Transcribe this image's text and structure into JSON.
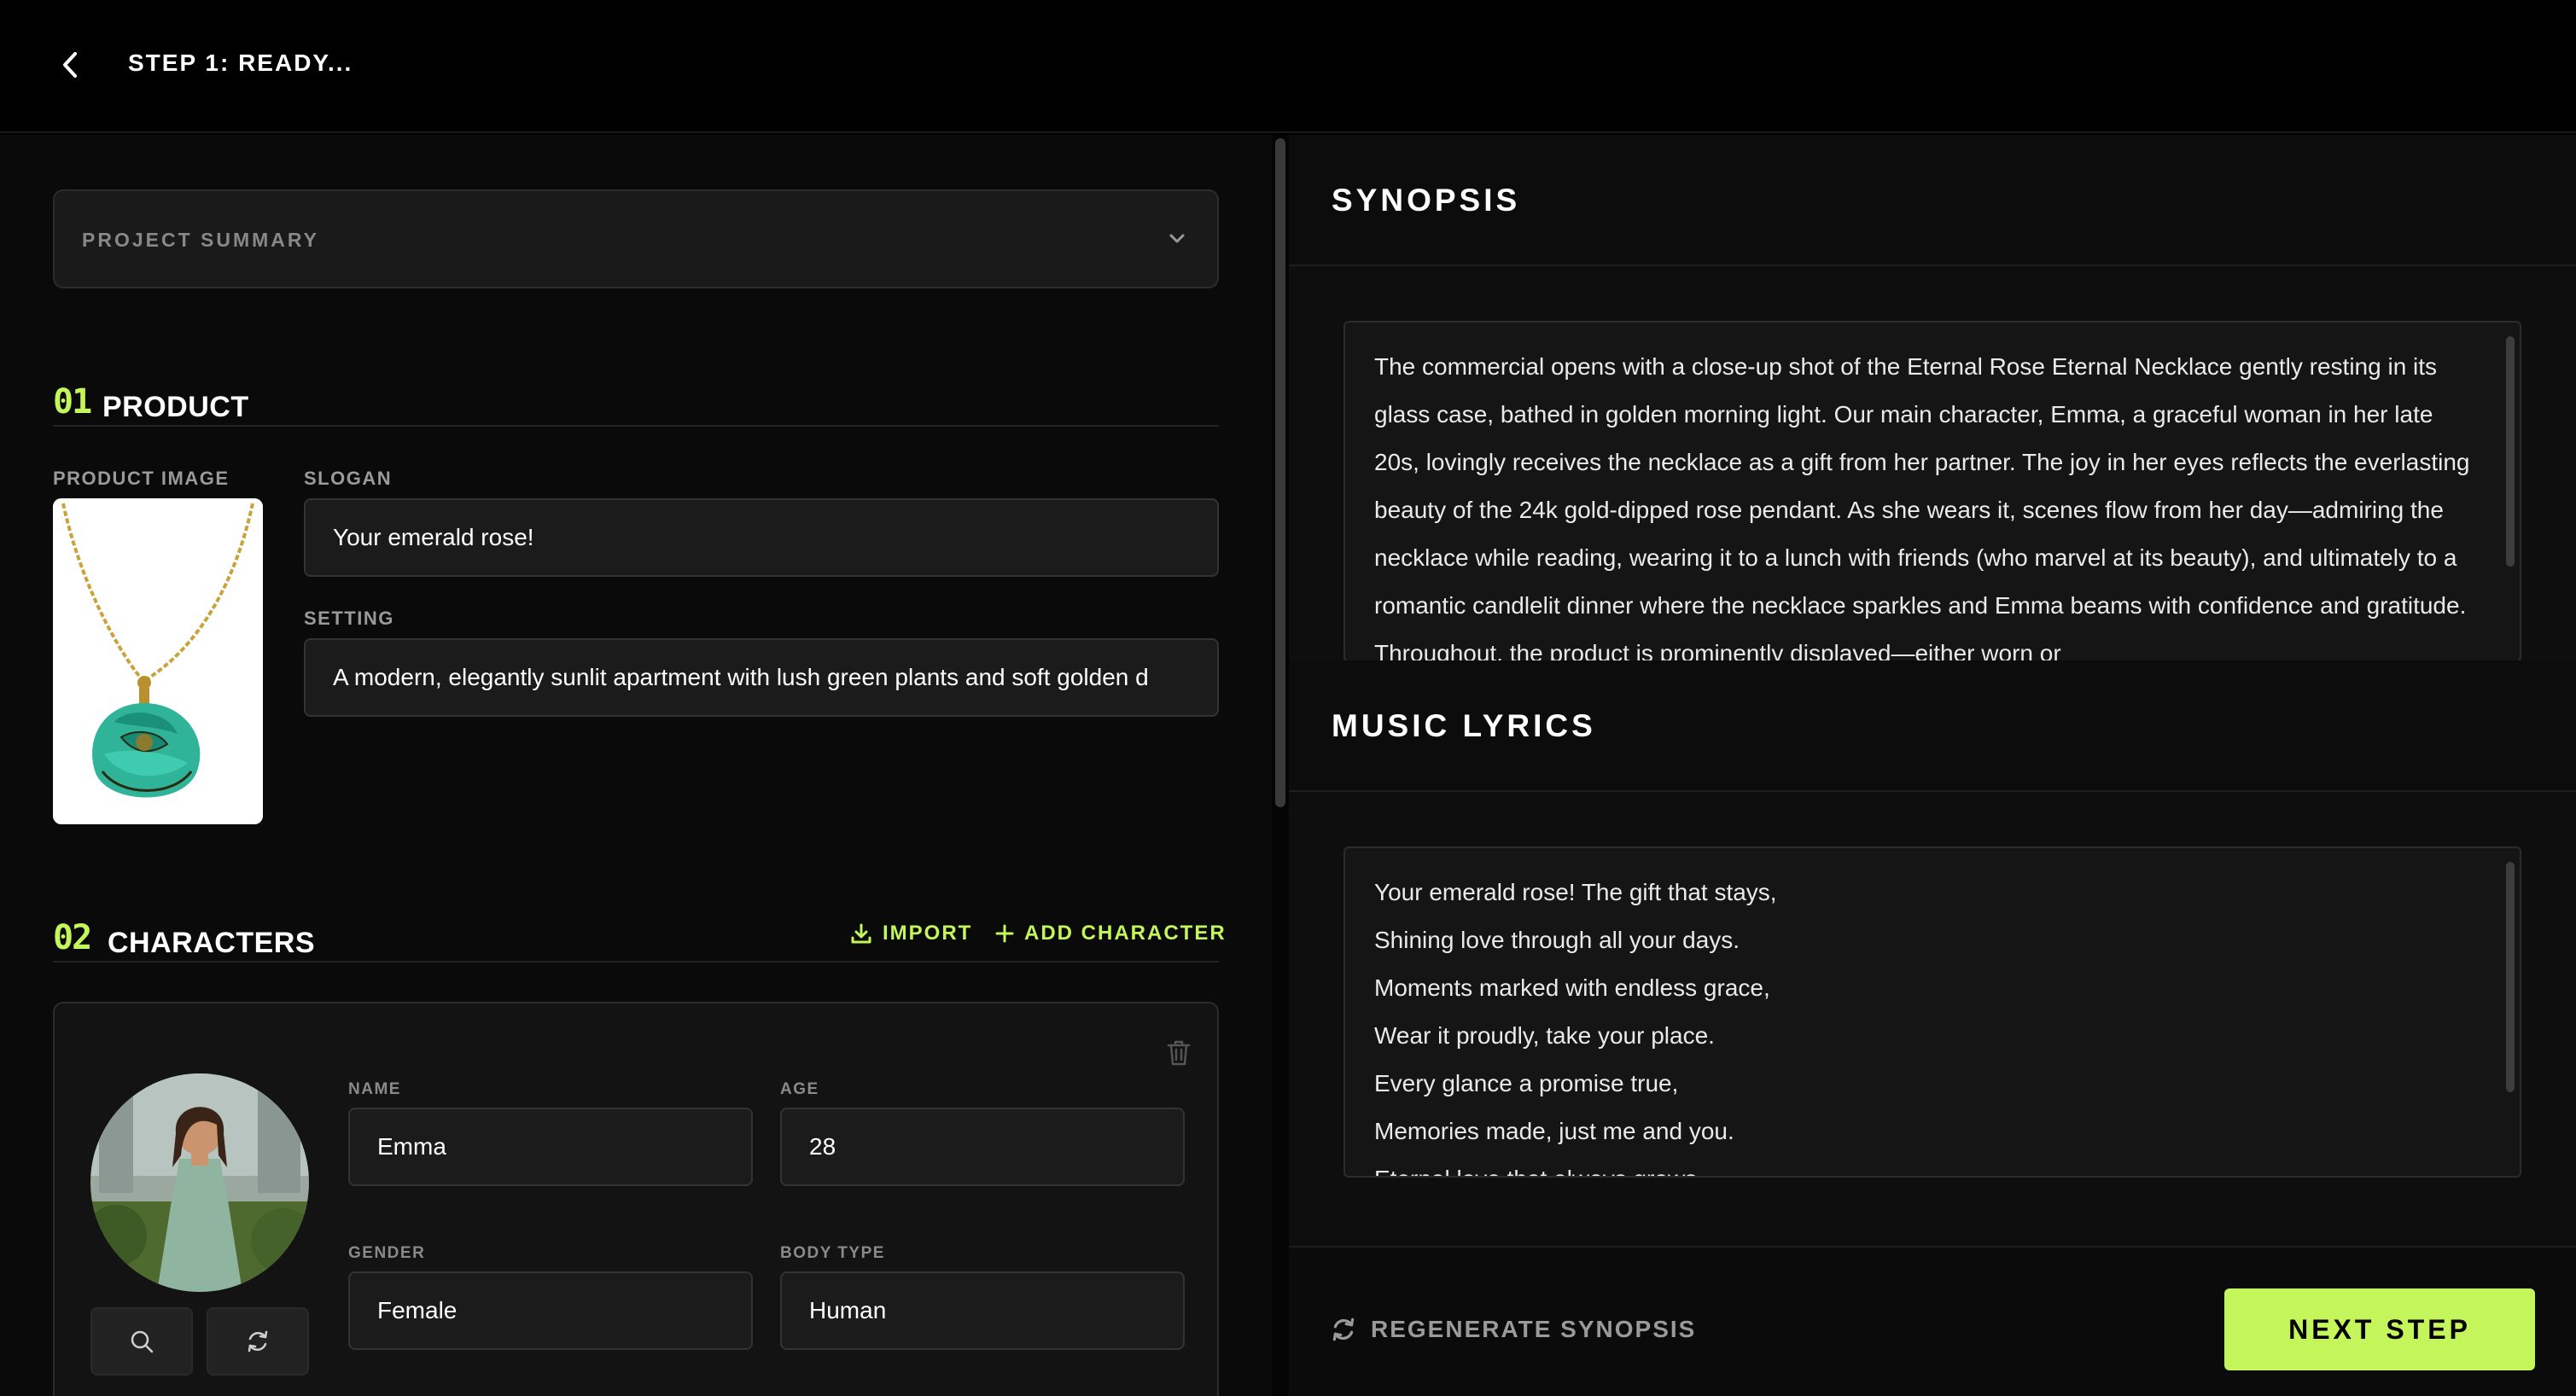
{
  "header": {
    "title": "STEP 1: READY..."
  },
  "summary": {
    "label": "PROJECT SUMMARY"
  },
  "product": {
    "number": "01",
    "title": "PRODUCT",
    "image_label": "PRODUCT IMAGE",
    "slogan_label": "SLOGAN",
    "slogan_value": "Your emerald rose!",
    "setting_label": "SETTING",
    "setting_value": "A modern, elegantly sunlit apartment with lush green plants and soft golden d"
  },
  "characters": {
    "number": "02",
    "title": "CHARACTERS",
    "import_label": "IMPORT",
    "add_label": "ADD CHARACTER",
    "items": [
      {
        "name_label": "NAME",
        "name": "Emma",
        "age_label": "AGE",
        "age": "28",
        "gender_label": "GENDER",
        "gender": "Female",
        "body_label": "BODY TYPE",
        "body": "Human"
      }
    ]
  },
  "synopsis": {
    "title": "SYNOPSIS",
    "text": "The commercial opens with a close-up shot of the Eternal Rose Eternal Necklace gently resting in its glass case, bathed in golden morning light. Our main character, Emma, a graceful woman in her late 20s, lovingly receives the necklace as a gift from her partner. The joy in her eyes reflects the everlasting beauty of the 24k gold-dipped rose pendant. As she wears it, scenes flow from her day—admiring the necklace while reading, wearing it to a lunch with friends (who marvel at its beauty), and ultimately to a romantic candlelit dinner where the necklace sparkles and Emma beams with confidence and gratitude. Throughout, the product is prominently displayed—either worn or"
  },
  "lyrics": {
    "title": "MUSIC LYRICS",
    "lines": [
      "Your emerald rose! The gift that stays,",
      "Shining love through all your days.",
      "Moments marked with endless grace,",
      "Wear it proudly, take your place.",
      "Every glance a promise true,",
      "Memories made, just me and you.",
      "Eternal love that always grows,"
    ]
  },
  "footer": {
    "regenerate_label": "REGENERATE SYNOPSIS",
    "next_label": "NEXT STEP"
  },
  "colors": {
    "accent": "#c4f55a",
    "background": "#000000",
    "panel": "#0a0a0a"
  },
  "icons": [
    "chevron-left-icon",
    "chevron-down-icon",
    "download-icon",
    "plus-icon",
    "trash-icon",
    "search-icon",
    "refresh-icon"
  ]
}
